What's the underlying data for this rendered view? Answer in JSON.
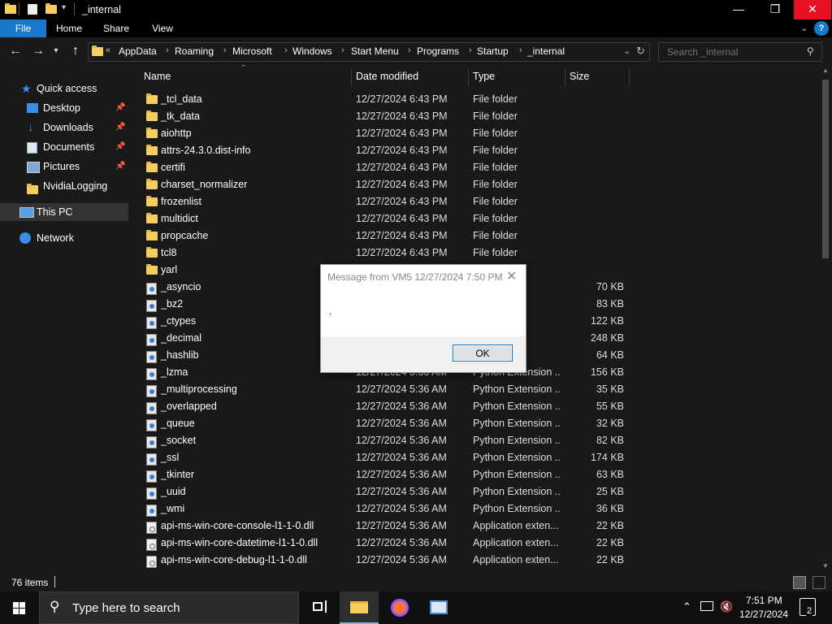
{
  "window": {
    "title": "_internal",
    "minimize": "—",
    "maximize": "❐",
    "close": "✕"
  },
  "ribbon": {
    "tabs": [
      "File",
      "Home",
      "Share",
      "View"
    ],
    "help": "?"
  },
  "address": {
    "overflow": "«",
    "crumbs": [
      "AppData",
      "Roaming",
      "Microsoft",
      "Windows",
      "Start Menu",
      "Programs",
      "Startup",
      "_internal"
    ],
    "refresh": "↻"
  },
  "search": {
    "placeholder": "Search _internal"
  },
  "nav": {
    "quick_access": "Quick access",
    "items": [
      {
        "label": "Desktop",
        "pinned": true
      },
      {
        "label": "Downloads",
        "pinned": true
      },
      {
        "label": "Documents",
        "pinned": true
      },
      {
        "label": "Pictures",
        "pinned": true
      },
      {
        "label": "NvidiaLogging",
        "pinned": false
      }
    ],
    "this_pc": "This PC",
    "network": "Network"
  },
  "columns": {
    "name": "Name",
    "date": "Date modified",
    "type": "Type",
    "size": "Size"
  },
  "files": [
    {
      "name": "_tcl_data",
      "date": "12/27/2024 6:43 PM",
      "type": "File folder",
      "size": "",
      "kind": "folder"
    },
    {
      "name": "_tk_data",
      "date": "12/27/2024 6:43 PM",
      "type": "File folder",
      "size": "",
      "kind": "folder"
    },
    {
      "name": "aiohttp",
      "date": "12/27/2024 6:43 PM",
      "type": "File folder",
      "size": "",
      "kind": "folder"
    },
    {
      "name": "attrs-24.3.0.dist-info",
      "date": "12/27/2024 6:43 PM",
      "type": "File folder",
      "size": "",
      "kind": "folder"
    },
    {
      "name": "certifi",
      "date": "12/27/2024 6:43 PM",
      "type": "File folder",
      "size": "",
      "kind": "folder"
    },
    {
      "name": "charset_normalizer",
      "date": "12/27/2024 6:43 PM",
      "type": "File folder",
      "size": "",
      "kind": "folder"
    },
    {
      "name": "frozenlist",
      "date": "12/27/2024 6:43 PM",
      "type": "File folder",
      "size": "",
      "kind": "folder"
    },
    {
      "name": "multidict",
      "date": "12/27/2024 6:43 PM",
      "type": "File folder",
      "size": "",
      "kind": "folder"
    },
    {
      "name": "propcache",
      "date": "12/27/2024 6:43 PM",
      "type": "File folder",
      "size": "",
      "kind": "folder"
    },
    {
      "name": "tcl8",
      "date": "12/27/2024 6:43 PM",
      "type": "File folder",
      "size": "",
      "kind": "folder"
    },
    {
      "name": "yarl",
      "date": "",
      "type": "",
      "size": "",
      "kind": "folder"
    },
    {
      "name": "_asyncio",
      "date": "",
      "type": "nsion ...",
      "size": "70 KB",
      "kind": "pyd"
    },
    {
      "name": "_bz2",
      "date": "",
      "type": "nsion ...",
      "size": "83 KB",
      "kind": "pyd"
    },
    {
      "name": "_ctypes",
      "date": "",
      "type": "nsion ...",
      "size": "122 KB",
      "kind": "pyd"
    },
    {
      "name": "_decimal",
      "date": "",
      "type": "nsion ...",
      "size": "248 KB",
      "kind": "pyd"
    },
    {
      "name": "_hashlib",
      "date": "",
      "type": "nsion ...",
      "size": "64 KB",
      "kind": "pyd"
    },
    {
      "name": "_lzma",
      "date": "12/27/2024 5:36 AM",
      "type": "Python Extension ...",
      "size": "156 KB",
      "kind": "pyd"
    },
    {
      "name": "_multiprocessing",
      "date": "12/27/2024 5:36 AM",
      "type": "Python Extension ...",
      "size": "35 KB",
      "kind": "pyd"
    },
    {
      "name": "_overlapped",
      "date": "12/27/2024 5:36 AM",
      "type": "Python Extension ...",
      "size": "55 KB",
      "kind": "pyd"
    },
    {
      "name": "_queue",
      "date": "12/27/2024 5:36 AM",
      "type": "Python Extension ...",
      "size": "32 KB",
      "kind": "pyd"
    },
    {
      "name": "_socket",
      "date": "12/27/2024 5:36 AM",
      "type": "Python Extension ...",
      "size": "82 KB",
      "kind": "pyd"
    },
    {
      "name": "_ssl",
      "date": "12/27/2024 5:36 AM",
      "type": "Python Extension ...",
      "size": "174 KB",
      "kind": "pyd"
    },
    {
      "name": "_tkinter",
      "date": "12/27/2024 5:36 AM",
      "type": "Python Extension ...",
      "size": "63 KB",
      "kind": "pyd"
    },
    {
      "name": "_uuid",
      "date": "12/27/2024 5:36 AM",
      "type": "Python Extension ...",
      "size": "25 KB",
      "kind": "pyd"
    },
    {
      "name": "_wmi",
      "date": "12/27/2024 5:36 AM",
      "type": "Python Extension ...",
      "size": "36 KB",
      "kind": "pyd"
    },
    {
      "name": "api-ms-win-core-console-l1-1-0.dll",
      "date": "12/27/2024 5:36 AM",
      "type": "Application exten...",
      "size": "22 KB",
      "kind": "dll"
    },
    {
      "name": "api-ms-win-core-datetime-l1-1-0.dll",
      "date": "12/27/2024 5:36 AM",
      "type": "Application exten...",
      "size": "22 KB",
      "kind": "dll"
    },
    {
      "name": "api-ms-win-core-debug-l1-1-0.dll",
      "date": "12/27/2024 5:36 AM",
      "type": "Application exten...",
      "size": "22 KB",
      "kind": "dll"
    }
  ],
  "status": {
    "item_count": "76 items"
  },
  "dialog": {
    "title": "Message from VM5 12/27/2024 7:50 PM",
    "message": ".",
    "ok": "OK",
    "close": "✕"
  },
  "taskbar": {
    "search_placeholder": "Type here to search",
    "time": "7:51 PM",
    "date": "12/27/2024",
    "notifications": "2"
  },
  "colors": {
    "accent": "#0078d7",
    "folder": "#f4cf5d",
    "background": "#191919",
    "selected": "#333333"
  }
}
